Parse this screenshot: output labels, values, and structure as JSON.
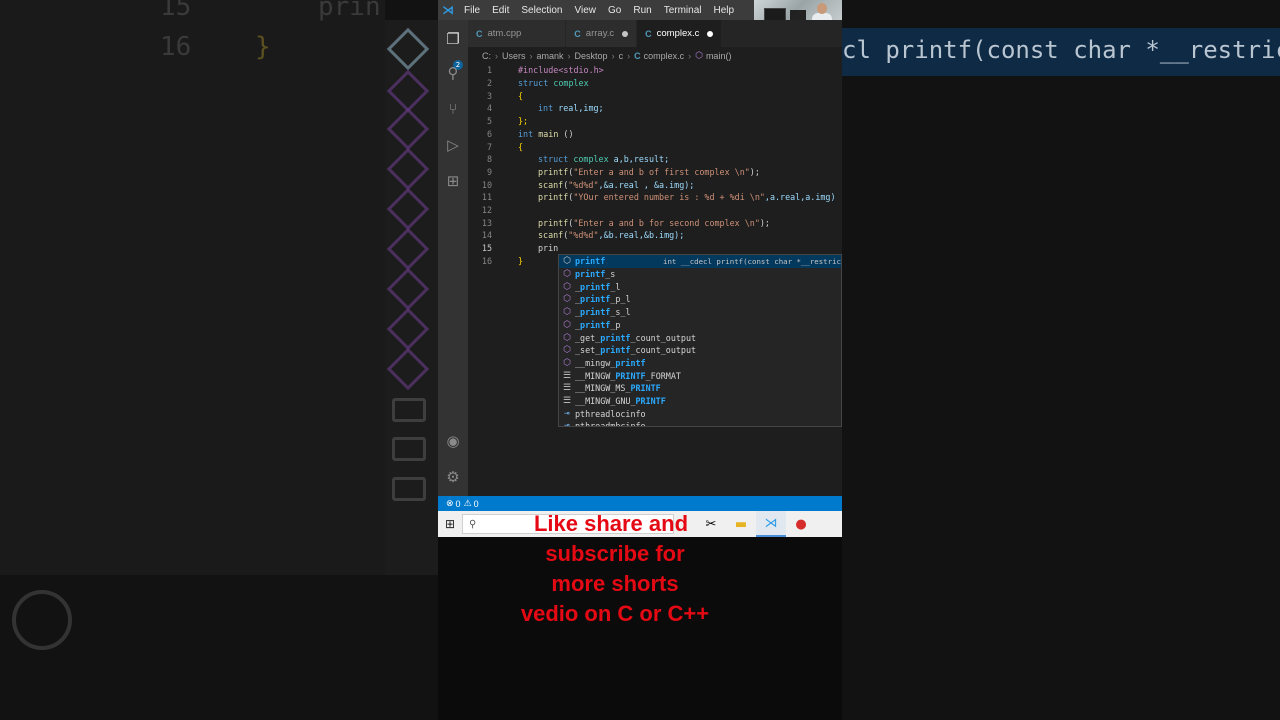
{
  "menu": [
    "File",
    "Edit",
    "Selection",
    "View",
    "Go",
    "Run",
    "Terminal",
    "Help"
  ],
  "tabs": [
    {
      "label": "atm.cpp",
      "icon": "c-file-icon"
    },
    {
      "label": "array.c",
      "icon": "c-file-icon"
    },
    {
      "label": "complex.c",
      "icon": "c-file-icon"
    }
  ],
  "breadcrumb": [
    "C:",
    "Users",
    "amank",
    "Desktop",
    "c",
    "complex.c",
    "main()"
  ],
  "explorer_badge": "2",
  "code": {
    "line_numbers": [
      "1",
      "2",
      "3",
      "4",
      "5",
      "6",
      "7",
      "8",
      "9",
      "10",
      "11",
      "12",
      "13",
      "14",
      "15",
      "16"
    ],
    "line1": "#include<stdio.h>",
    "line2_kw": "struct",
    "line2_name": "complex",
    "line3": "{",
    "line4_kw": "int",
    "line4_rest": "real,img;",
    "line5": "};",
    "line6_kw": "int",
    "line6_fn": "main",
    "line6_rest": "()",
    "line7": "{",
    "line8_kw": "struct",
    "line8_ty": "complex",
    "line8_rest": "a,b,result;",
    "line9_fn": "printf",
    "line9_str": "\"Enter a and b of first complex \\n\"",
    "line9_end": ");",
    "line10_fn": "scanf",
    "line10_str": "\"%d%d\"",
    "line10_rest": ",&a.real , &a.img);",
    "line11_fn": "printf",
    "line11_str": "\"YOur entered number is : %d + %di \\n\"",
    "line11_rest": ",a.real,a.img)",
    "line13_fn": "printf",
    "line13_str": "\"Enter a and b for second complex \\n\"",
    "line13_end": ");",
    "line14_fn": "scanf",
    "line14_str": "\"%d%d\"",
    "line14_rest": ",&b.real,&b.img);",
    "line15": "prin",
    "line16": "}"
  },
  "suggestions": [
    {
      "hl": "printf",
      "rest": "",
      "icon": "cube-icon",
      "detail": "int __cdecl printf(const char *__restrict"
    },
    {
      "hl": "printf",
      "rest": "_s",
      "icon": "cube-icon"
    },
    {
      "pre": "_",
      "hl": "printf",
      "rest": "_l",
      "icon": "cube-icon"
    },
    {
      "pre": "_",
      "hl": "printf",
      "rest": "_p_l",
      "icon": "cube-icon"
    },
    {
      "pre": "_",
      "hl": "printf",
      "rest": "_s_l",
      "icon": "cube-icon"
    },
    {
      "pre": "_",
      "hl": "printf",
      "rest": "_p",
      "icon": "cube-icon"
    },
    {
      "pre": "_get_",
      "hl": "printf",
      "rest": "_count_output",
      "icon": "cube-icon"
    },
    {
      "pre": "_set_",
      "hl": "printf",
      "rest": "_count_output",
      "icon": "cube-icon"
    },
    {
      "pre": "__mingw_",
      "hl": "printf",
      "rest": "",
      "icon": "cube-icon"
    },
    {
      "pre": "__MINGW_",
      "hl": "PRINTF",
      "rest": "_FORMAT",
      "icon": "list-icon"
    },
    {
      "pre": "__MINGW_MS_",
      "hl": "PRINTF",
      "rest": "",
      "icon": "list-icon"
    },
    {
      "pre": "__MINGW_GNU_",
      "hl": "PRINTF",
      "rest": "",
      "icon": "list-icon"
    },
    {
      "pre": "pthreadlocinfo",
      "hl": "",
      "rest": "",
      "icon": "field-icon"
    },
    {
      "pre": "pthreadmbcinfo",
      "hl": "",
      "rest": "",
      "icon": "field-icon"
    }
  ],
  "status": {
    "errors": "0",
    "warnings": "0"
  },
  "overlay_text": [
    "Like share and",
    "subscribe for",
    "more shorts",
    "vedio on C or C++"
  ],
  "bg_right_text": "cl printf(const char *__restrict",
  "bg_left_lines": [
    "15",
    "16",
    "prin",
    "}"
  ],
  "colors": {
    "accent": "#007acc",
    "overlay_text": "#e50914",
    "keyword": "#569cd6",
    "string": "#ce9178"
  }
}
